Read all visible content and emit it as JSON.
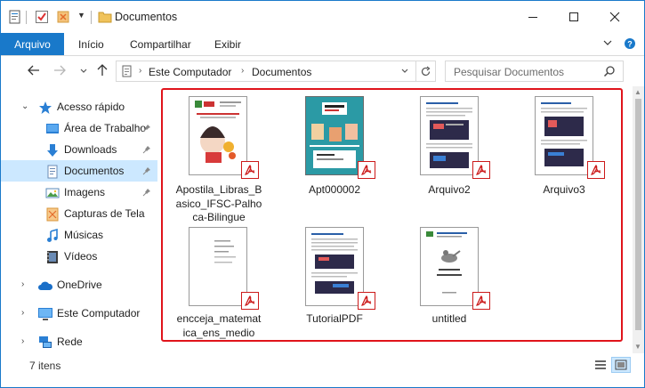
{
  "window": {
    "title": "Documentos",
    "minimize_glyph": "—",
    "maximize_glyph": "☐",
    "close_glyph": "✕"
  },
  "ribbon": {
    "tabs": [
      "Arquivo",
      "Início",
      "Compartilhar",
      "Exibir"
    ]
  },
  "address": {
    "segments": [
      "Este Computador",
      "Documentos"
    ],
    "separator": "›"
  },
  "search": {
    "placeholder": "Pesquisar Documentos"
  },
  "sidebar": {
    "chevron": "›",
    "items": [
      {
        "label": "Acesso rápido",
        "icon": "star-icon",
        "pinned": false
      },
      {
        "label": "Área de Trabalho",
        "icon": "desktop-icon",
        "pinned": true
      },
      {
        "label": "Downloads",
        "icon": "download-icon",
        "pinned": true
      },
      {
        "label": "Documentos",
        "icon": "document-icon",
        "pinned": true,
        "selected": true
      },
      {
        "label": "Imagens",
        "icon": "image-icon",
        "pinned": true
      },
      {
        "label": "Capturas de Tela",
        "icon": "folder-icon",
        "pinned": false
      },
      {
        "label": "Músicas",
        "icon": "music-icon",
        "pinned": false
      },
      {
        "label": "Vídeos",
        "icon": "video-icon",
        "pinned": false
      },
      {
        "label": "OneDrive",
        "icon": "cloud-icon",
        "pinned": false
      },
      {
        "label": "Este Computador",
        "icon": "computer-icon",
        "pinned": false
      },
      {
        "label": "Rede",
        "icon": "network-icon",
        "pinned": false
      }
    ]
  },
  "files": [
    {
      "name": "Apostila_Libras_Basico_IFSC-Palhoca-Bilingue",
      "lines": [
        "Apostila_Libras_B",
        "asico_IFSC-Palho",
        "ca-Bilingue"
      ],
      "type": "pdf"
    },
    {
      "name": "Apt000002",
      "lines": [
        "Apt000002"
      ],
      "type": "pdf"
    },
    {
      "name": "Arquivo2",
      "lines": [
        "Arquivo2"
      ],
      "type": "pdf"
    },
    {
      "name": "Arquivo3",
      "lines": [
        "Arquivo3"
      ],
      "type": "pdf"
    },
    {
      "name": "encceja_matematica_ens_medio",
      "lines": [
        "encceja_matemat",
        "ica_ens_medio"
      ],
      "type": "pdf"
    },
    {
      "name": "TutorialPDF",
      "lines": [
        "TutorialPDF"
      ],
      "type": "pdf"
    },
    {
      "name": "untitled",
      "lines": [
        "untitled"
      ],
      "type": "pdf"
    }
  ],
  "status": {
    "item_count": "7 itens"
  },
  "colors": {
    "accent": "#1979ca",
    "selection": "#cce8ff",
    "highlight_border": "#e0141b",
    "pdf_red": "#cc1a1a"
  }
}
